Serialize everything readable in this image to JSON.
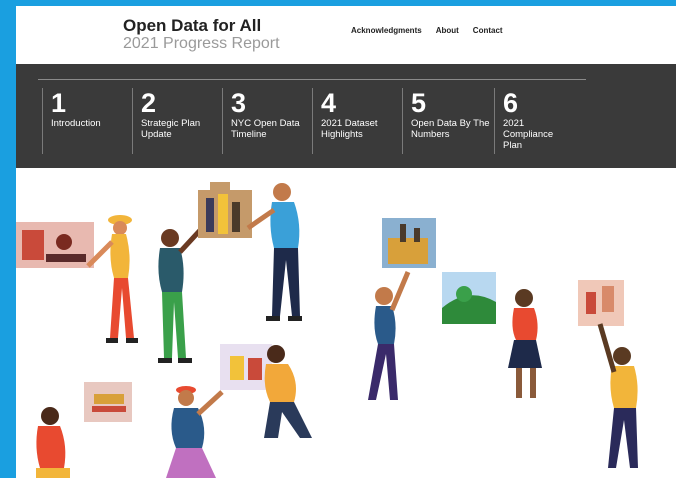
{
  "header": {
    "title": "Open Data for All",
    "subtitle": "2021 Progress Report",
    "nav": [
      "Acknowledgments",
      "About",
      "Contact"
    ]
  },
  "sections": [
    {
      "number": "1",
      "label": "Introduction"
    },
    {
      "number": "2",
      "label": "Strategic Plan Update"
    },
    {
      "number": "3",
      "label": "NYC Open Data Timeline"
    },
    {
      "number": "4",
      "label": "2021 Dataset Highlights"
    },
    {
      "number": "5",
      "label": "Open Data By The Numbers"
    },
    {
      "number": "6",
      "label": "2021 Compliance Plan"
    }
  ],
  "colors": {
    "frame": "#1a9fe0",
    "band": "#3a3a3a",
    "subtitle": "#9a9a9a"
  }
}
